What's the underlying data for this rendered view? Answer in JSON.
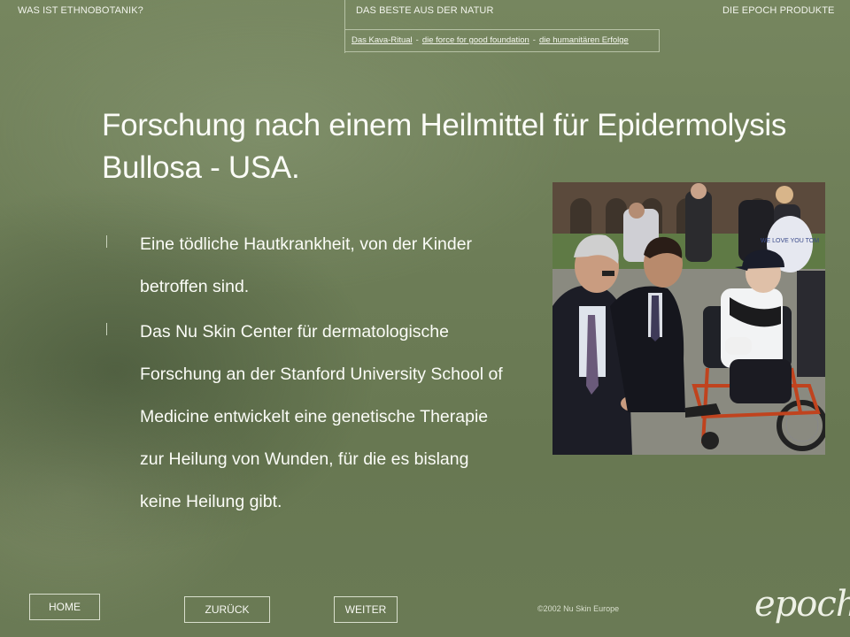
{
  "nav": {
    "item1": "WAS IST ETHNOBOTANIK?",
    "item2": "DAS BESTE AUS DER NATUR",
    "item3": "DIE EPOCH PRODUKTE"
  },
  "subnav": {
    "link1": "Das Kava-Ritual",
    "sep": "-",
    "link2": "die force for good foundation",
    "link3": "die humanitären Erfolge"
  },
  "title": "Forschung nach einem Heilmittel für Epidermolysis Bullosa - USA.",
  "bullets": [
    "Eine tödliche Hautkrankheit, von der Kinder betroffen sind.",
    "Das Nu Skin Center für dermatologische Forschung an der Stanford University School of Medicine entwickelt eine genetische Therapie zur Heilung von Wunden, für die es bislang keine Heilung gibt."
  ],
  "photo": {
    "sign_text": "WE LOVE YOU TOM"
  },
  "buttons": {
    "home": "HOME",
    "back": "ZURÜCK",
    "next": "WEITER"
  },
  "copyright": "©2002 Nu Skin Europe",
  "logo": "epoch."
}
